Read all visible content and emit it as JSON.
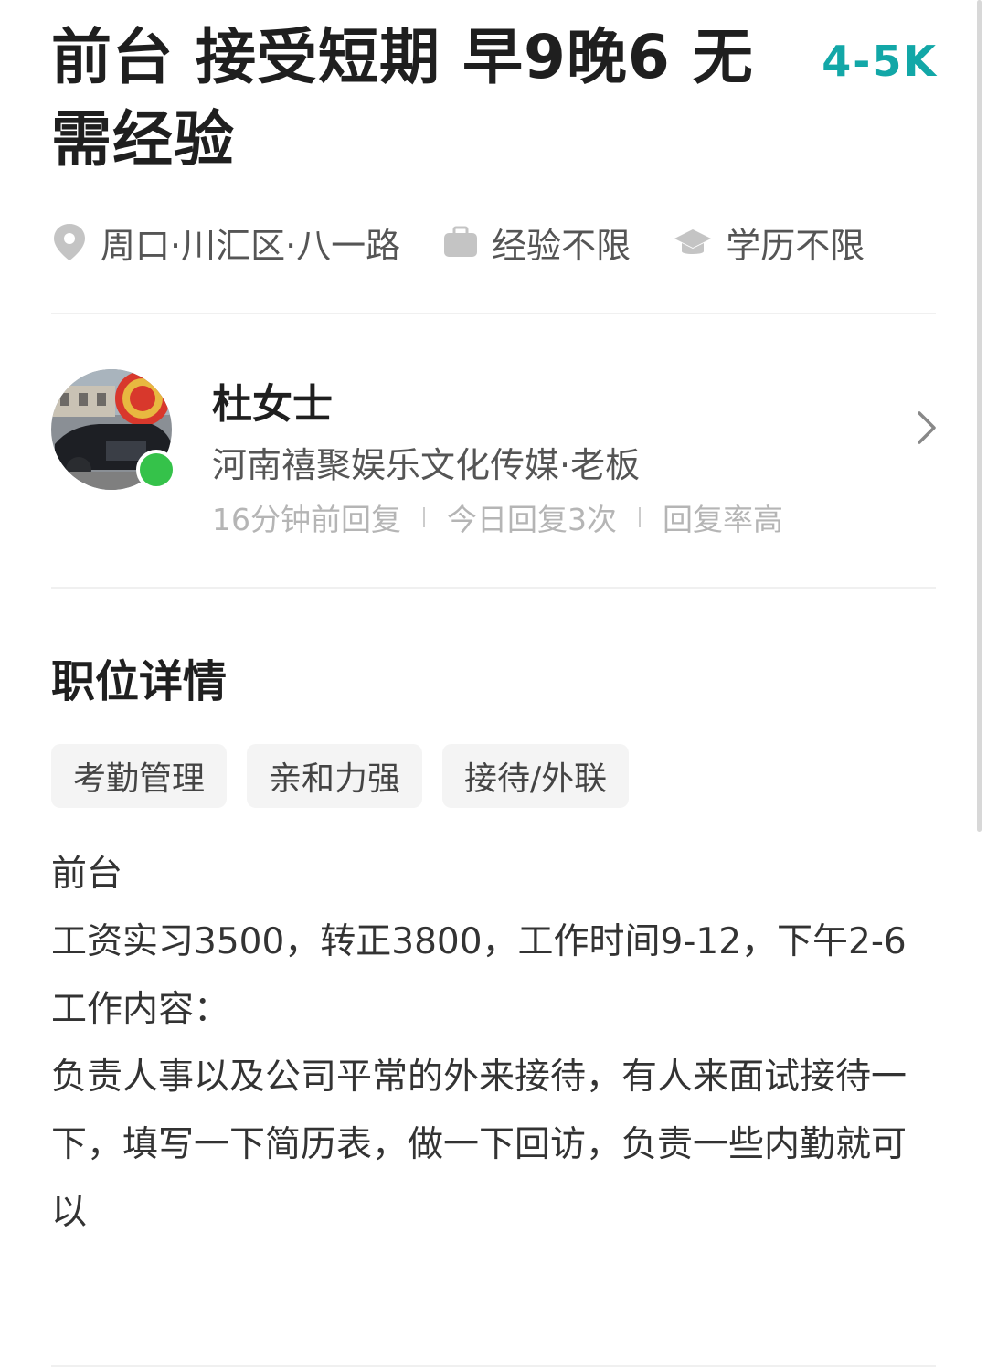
{
  "job": {
    "title": "前台 接受短期 早9晚6 无需经验",
    "salary": "4-5K",
    "location": "周口·川汇区·八一路",
    "experience": "经验不限",
    "education": "学历不限"
  },
  "recruiter": {
    "name": "杜女士",
    "company": "河南禧聚娱乐文化传媒·老板",
    "stats": [
      "16分钟前回复",
      "今日回复3次",
      "回复率高"
    ],
    "online": true
  },
  "details": {
    "section_title": "职位详情",
    "tags": [
      "考勤管理",
      "亲和力强",
      "接待/外联"
    ],
    "lines": [
      "前台",
      "工资实习3500，转正3800，工作时间9-12，下午2-6",
      "工作内容：",
      "负责人事以及公司平常的外来接待，有人来面试接待一下，填写一下简历表，做一下回访，负责一些内勤就可以"
    ]
  },
  "colors": {
    "salary": "#12a7a7",
    "online": "#35c24a"
  },
  "icons": [
    "location-pin-icon",
    "briefcase-icon",
    "graduation-cap-icon",
    "chevron-right-icon"
  ]
}
